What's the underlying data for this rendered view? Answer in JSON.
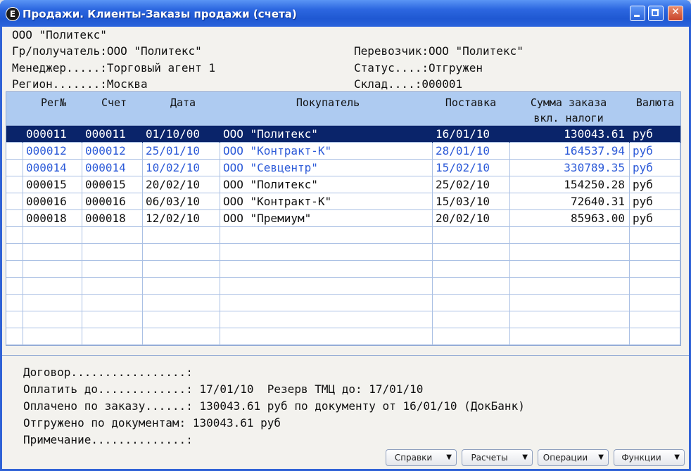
{
  "window": {
    "title": "Продажи. Клиенты-Заказы продажи (счета)",
    "app_icon": "E"
  },
  "header": {
    "client": "ООО \"Политекс\"",
    "recipient_group": "Гр/получатель:ООО \"Политекс\"",
    "manager": "Менеджер.....:Торговый агент 1",
    "region": "Регион.......:Москва",
    "carrier": "Перевозчик:ООО \"Политекс\"",
    "status": "Статус....:Отгружен",
    "warehouse": "Склад....:000001"
  },
  "table": {
    "columns": [
      "Рег№",
      "Счет",
      "Дата",
      "Покупатель",
      "Поставка",
      "Сумма заказа\nвкл. налоги",
      "Валюта"
    ],
    "rows": [
      {
        "reg": "000011",
        "invoice": "000011",
        "date": "01/10/00",
        "buyer": "ООО \"Политекс\"",
        "delivery": "16/01/10",
        "sum": "130043.61",
        "currency": "руб"
      },
      {
        "reg": "000012",
        "invoice": "000012",
        "date": "25/01/10",
        "buyer": "ООО \"Контракт-К\"",
        "delivery": "28/01/10",
        "sum": "164537.94",
        "currency": "руб"
      },
      {
        "reg": "000014",
        "invoice": "000014",
        "date": "10/02/10",
        "buyer": "ООО \"Севцентр\"",
        "delivery": "15/02/10",
        "sum": "330789.35",
        "currency": "руб"
      },
      {
        "reg": "000015",
        "invoice": "000015",
        "date": "20/02/10",
        "buyer": "ООО \"Политекс\"",
        "delivery": "25/02/10",
        "sum": "154250.28",
        "currency": "руб"
      },
      {
        "reg": "000016",
        "invoice": "000016",
        "date": "06/03/10",
        "buyer": "ООО \"Контракт-К\"",
        "delivery": "15/03/10",
        "sum": "72640.31",
        "currency": "руб"
      },
      {
        "reg": "000018",
        "invoice": "000018",
        "date": "12/02/10",
        "buyer": "ООО \"Премиум\"",
        "delivery": "20/02/10",
        "sum": "85963.00",
        "currency": "руб"
      }
    ]
  },
  "details": {
    "contract": "Договор.................:",
    "pay_by": "Оплатить до.............: 17/01/10  Резерв ТМЦ до: 17/01/10",
    "paid": "Оплачено по заказу......: 130043.61 руб по документу от 16/01/10 (ДокБанк)",
    "shipped": "Отгружено по документам: 130043.61 руб",
    "note": "Примечание..............:"
  },
  "buttons": {
    "references": "Справки",
    "calculations": "Расчеты",
    "operations": "Операции",
    "functions": "Функции"
  },
  "colors": {
    "titlebar": "#2c67e0",
    "selected_row": "#0a246a",
    "header_row": "#aecbf1",
    "blue_text": "#2c5ad8"
  }
}
